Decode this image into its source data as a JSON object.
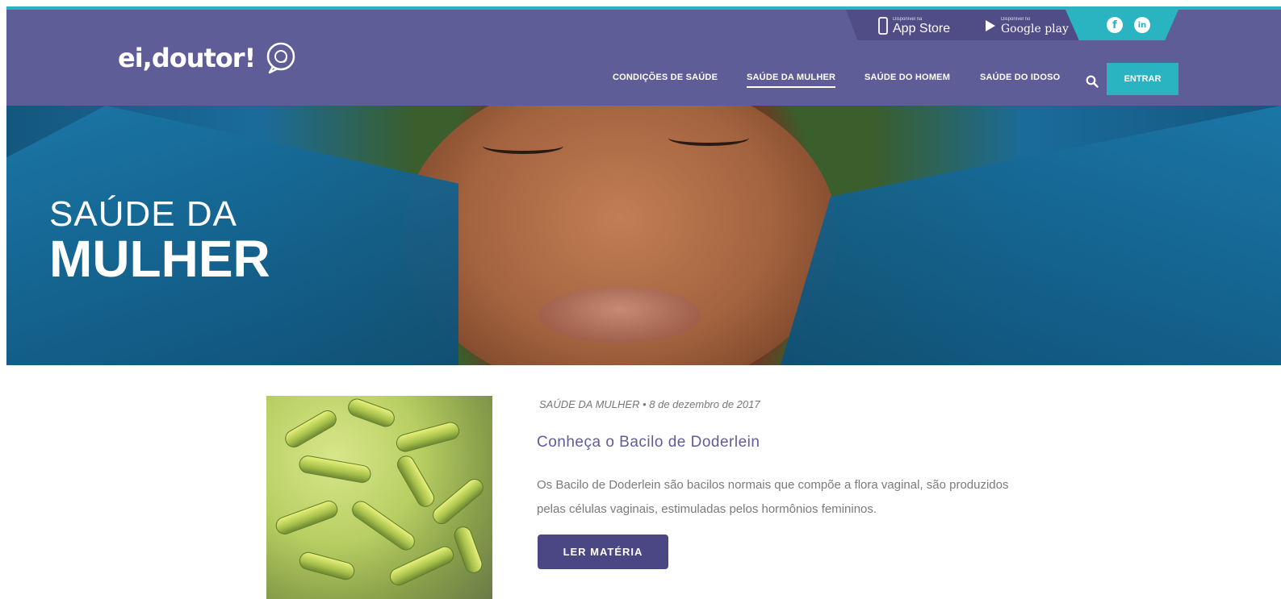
{
  "header": {
    "logo_text": "ei,doutor!",
    "stores": {
      "appstore_small": "Disponível na",
      "appstore_label": "App Store",
      "googleplay_small": "Disponível no",
      "googleplay_label": "Google play"
    },
    "social": {
      "facebook_glyph": "f",
      "linkedin_glyph": "in"
    },
    "nav": [
      {
        "label": "CONDIÇÕES DE SAÚDE"
      },
      {
        "label": "SAÚDE DA MULHER",
        "active": true
      },
      {
        "label": "SAÚDE DO HOMEM"
      },
      {
        "label": "SAÚDE DO IDOSO"
      }
    ],
    "login_label": "ENTRAR"
  },
  "hero": {
    "title_line1": "SAÚDE DA",
    "title_line2": "MULHER"
  },
  "article": {
    "meta": "SAÚDE DA MULHER • 8 de dezembro de 2017",
    "title": "Conheça o Bacilo de Doderlein",
    "excerpt": "Os Bacilo de Doderlein são bacilos normais que compõe a flora vaginal, são produzidos pelas células vaginais, estimuladas pelos hormônios femininos.",
    "cta": "LER MATÉRIA"
  },
  "colors": {
    "header_bg": "#5f5d98",
    "accent_teal": "#2ab3c0",
    "button_dark": "#4a4784"
  },
  "icons": [
    "chat-bubble-icon",
    "phone-icon",
    "play-icon",
    "facebook-icon",
    "linkedin-icon",
    "search-icon"
  ]
}
